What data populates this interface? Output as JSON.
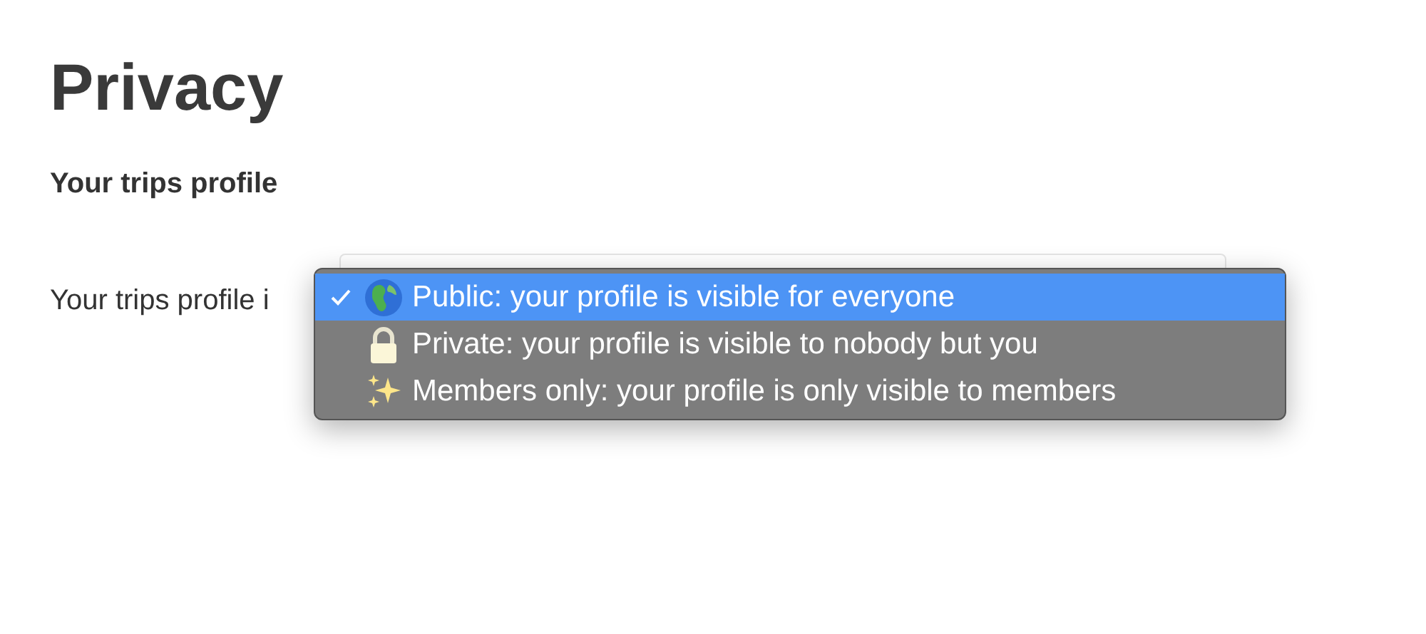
{
  "page": {
    "title": "Privacy"
  },
  "section": {
    "heading": "Your trips profile",
    "field_label": "Your trips profile i"
  },
  "dropdown": {
    "options": [
      {
        "kind": "globe",
        "label": "Public: your profile is visible for everyone",
        "selected": true
      },
      {
        "kind": "lock",
        "label": "Private: your profile is visible to nobody but you",
        "selected": false
      },
      {
        "kind": "sparkles",
        "label": "Members only: your profile is only visible to members",
        "selected": false
      }
    ]
  }
}
